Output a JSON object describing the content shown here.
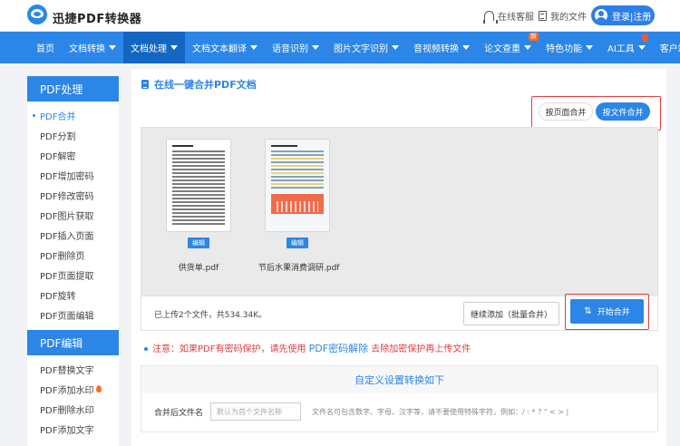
{
  "header": {
    "brand": "迅捷PDF转换器",
    "service_label": "在线客服",
    "files_label": "我的文件",
    "login_label": "登录|注册"
  },
  "nav": {
    "items": [
      {
        "label": "首页",
        "caret": false
      },
      {
        "label": "文档转换",
        "caret": true
      },
      {
        "label": "文档处理",
        "caret": true,
        "active": true
      },
      {
        "label": "文档文本翻译",
        "caret": true
      },
      {
        "label": "语音识别",
        "caret": true
      },
      {
        "label": "图片文字识别",
        "caret": true
      },
      {
        "label": "音视频转换",
        "caret": true
      },
      {
        "label": "论文查重",
        "caret": true,
        "badge": "新"
      },
      {
        "label": "特色功能",
        "caret": true
      },
      {
        "label": "AI工具",
        "caret": true,
        "fire": true
      },
      {
        "label": "客户端",
        "caret": true
      }
    ]
  },
  "sidebar": {
    "group1_title": "PDF处理",
    "group1_items": [
      "PDF合并",
      "PDF分割",
      "PDF解密",
      "PDF增加密码",
      "PDF修改密码",
      "PDF图片获取",
      "PDF插入页面",
      "PDF删除页",
      "PDF页面提取",
      "PDF旋转",
      "PDF页面编辑"
    ],
    "group2_title": "PDF编辑",
    "group2_items": [
      "PDF替换文字",
      "PDF添加水印",
      "PDF删除水印",
      "PDF添加文字"
    ]
  },
  "main": {
    "title": "在线一键合并PDF文档",
    "mode_page": "按页面合并",
    "mode_file": "按文件合并",
    "files": [
      {
        "name": "供货单.pdf",
        "edit_label": "编辑"
      },
      {
        "name": "节后水果消费调研.pdf",
        "edit_label": "编辑"
      }
    ],
    "upload_info": "已上传2个文件，共534.34K。",
    "add_label": "继续添加（批量合并）",
    "merge_label": "开始合并",
    "notice_prefix": "注意：如果PDF有密码保护，请先使用",
    "notice_link": "PDF密码解除",
    "notice_suffix": "去除加密保护再上传文件",
    "settings_title": "自定义设置转换如下",
    "filename_label": "合并后文件名",
    "filename_placeholder": "默认为首个文件名称",
    "filename_hint": "文件名可包含数字、字母、汉字等，请不要使用特殊字符，例如：/ : * ? \" < > |"
  },
  "colors": {
    "primary": "#2b86e8",
    "nav_active": "#1367c2",
    "warning": "#e13d3d"
  }
}
